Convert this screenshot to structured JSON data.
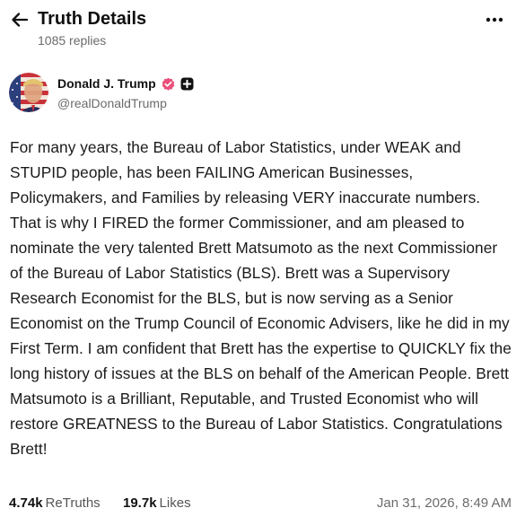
{
  "header": {
    "title": "Truth Details",
    "reply_count": "1085 replies"
  },
  "author": {
    "name": "Donald J. Trump",
    "handle": "@realDonaldTrump"
  },
  "post": {
    "text": "For many years, the Bureau of Labor Statistics, under WEAK and STUPID people, has been FAILING American Businesses, Policymakers, and Families by releasing VERY inaccurate numbers. That is why I FIRED the former Commissioner, and am pleased to nominate the very talented Brett Matsumoto as the next Commissioner of the Bureau of Labor Statistics (BLS). Brett was a Supervisory Research Economist for the BLS, but is now serving as a Senior Economist on the Trump Council of Economic Advisers, like he did in my First Term. I am confident that Brett has the expertise to QUICKLY fix the long history of issues at the BLS on behalf of the American People. Brett Matsumoto is a Brilliant, Reputable, and Trusted Economist who will restore GREATNESS to the Bureau of Labor Statistics. Congratulations Brett!"
  },
  "stats": {
    "retruths_count": "4.74k",
    "retruths_label": "ReTruths",
    "likes_count": "19.7k",
    "likes_label": "Likes",
    "timestamp": "Jan 31, 2026, 8:49 AM"
  },
  "colors": {
    "verified_badge": "#e9507a",
    "text_primary": "#111111",
    "text_secondary": "#6b6b6b"
  },
  "icons": {
    "back": "arrow-left-icon",
    "more": "more-horizontal-icon",
    "verified": "verified-badge-icon",
    "plus": "plus-badge-icon"
  }
}
